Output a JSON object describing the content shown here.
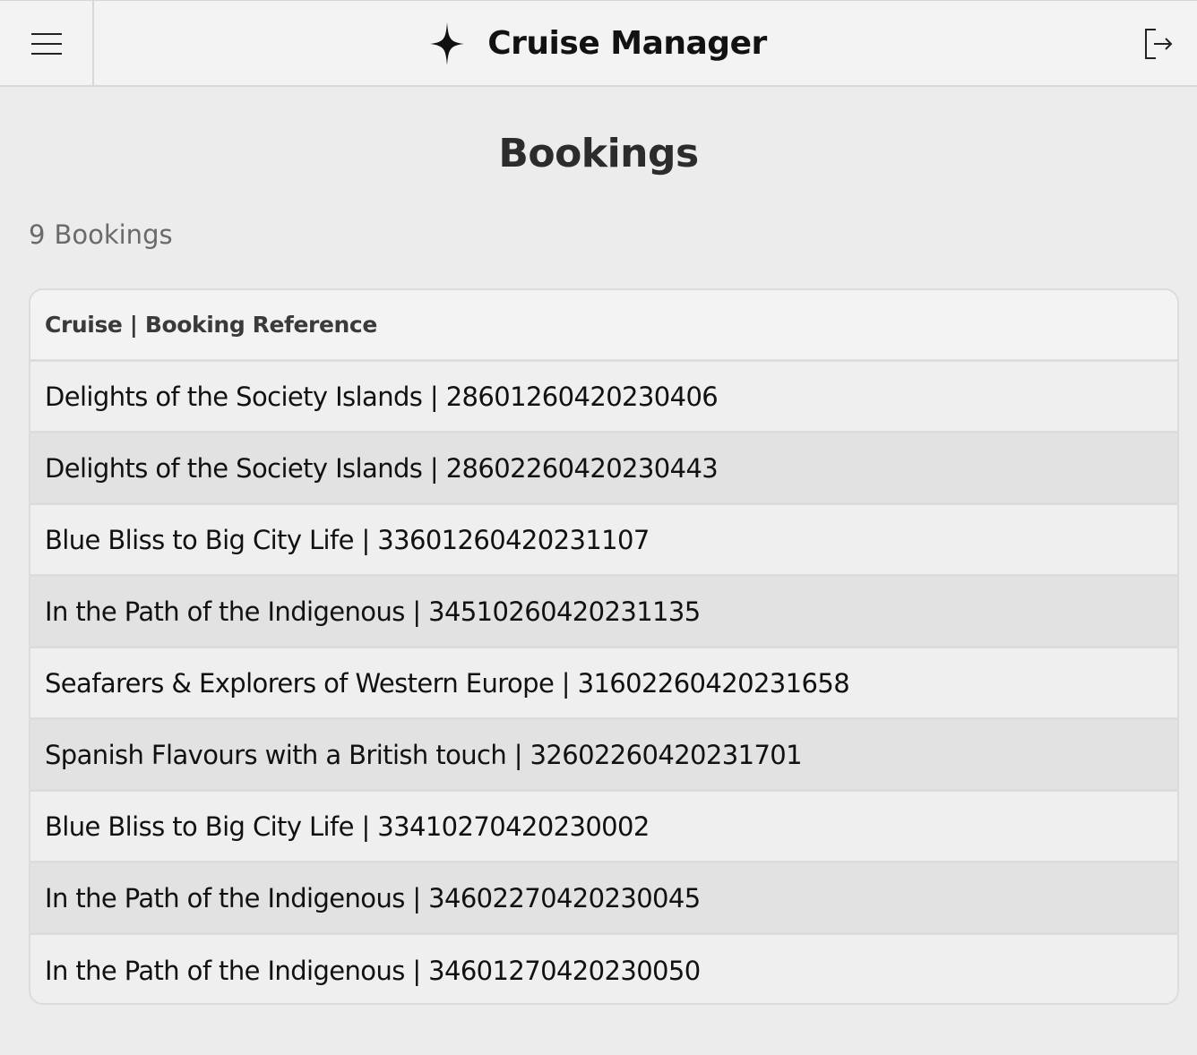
{
  "header": {
    "app_title": "Cruise Manager",
    "menu_icon": "hamburger-menu-icon",
    "logo_icon": "sparkle-star-icon",
    "logout_icon": "logout-icon"
  },
  "page": {
    "title": "Bookings",
    "count_number": "9",
    "count_label": "Bookings"
  },
  "table": {
    "header": "Cruise | Booking Reference",
    "rows": [
      "Delights of the Society Islands | 28601260420230406",
      "Delights of the Society Islands | 28602260420230443",
      "Blue Bliss to Big City Life | 33601260420231107",
      "In the Path of the Indigenous | 34510260420231135",
      "Seafarers & Explorers of Western Europe | 31602260420231658",
      "Spanish Flavours with a British touch | 32602260420231701",
      "Blue Bliss to Big City Life | 33410270420230002",
      "In the Path of the Indigenous | 34602270420230045",
      "In the Path of the Indigenous | 34601270420230050"
    ]
  },
  "colors": {
    "background": "#ececec",
    "header_bg": "#f3f3f3",
    "row_alt": "#e2e2e2",
    "border": "#dcdcdc"
  }
}
